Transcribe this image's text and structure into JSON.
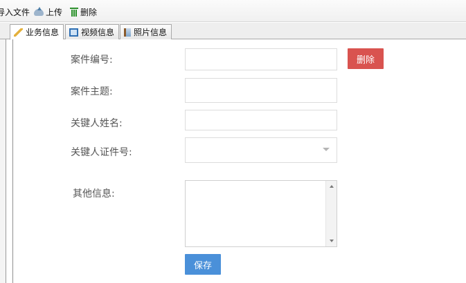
{
  "toolbar": {
    "import_label": "导入文件",
    "upload_label": "上传",
    "delete_label": "删除"
  },
  "tabs": [
    {
      "label": "业务信息",
      "icon": "pencil-icon",
      "active": true
    },
    {
      "label": "视频信息",
      "icon": "film-icon",
      "active": false
    },
    {
      "label": "照片信息",
      "icon": "photo-icon",
      "active": false
    }
  ],
  "form": {
    "case_number_label": "案件编号:",
    "case_number_value": "",
    "case_subject_label": "案件主题:",
    "case_subject_value": "",
    "key_person_name_label": "关键人姓名:",
    "key_person_name_value": "",
    "key_person_id_label": "关键人证件号:",
    "key_person_id_value": "",
    "other_info_label": "其他信息:",
    "other_info_value": "",
    "delete_button": "删除",
    "save_button": "保存"
  },
  "colors": {
    "delete_button": "#d9534f",
    "save_button": "#4a90d9"
  }
}
